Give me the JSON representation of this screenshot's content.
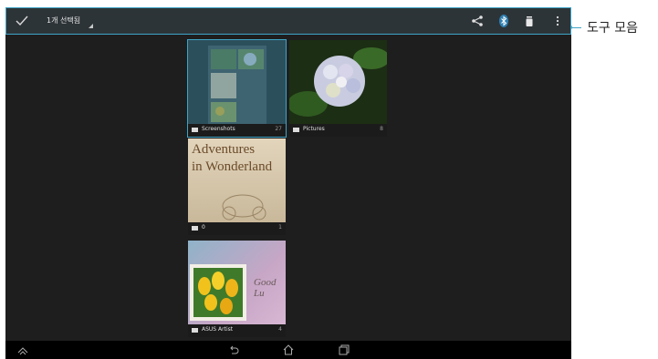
{
  "actionbar": {
    "selected_text": "1개 선택됨",
    "icons": [
      "check-icon",
      "share-icon",
      "bluetooth-icon",
      "delete-icon",
      "overflow-menu-icon"
    ]
  },
  "callout": {
    "label": "도구 모음"
  },
  "albums": [
    {
      "name": "Screenshots",
      "count": "27"
    },
    {
      "name": "Pictures",
      "count": "8"
    },
    {
      "name": "0",
      "count": "1"
    },
    {
      "name": "ASUS Artist",
      "count": "4"
    }
  ],
  "thumbnails": {
    "wonderland_line1": "Adventures",
    "wonderland_line2": "in Wonderland",
    "postcard_text": "Good Lu"
  },
  "navbar": {
    "icons": [
      "up-icon",
      "back-icon",
      "home-icon",
      "recent-apps-icon"
    ]
  },
  "colors": {
    "accent": "#3fa4c6",
    "background": "#1e1e1e",
    "actionbar": "#2d3438"
  }
}
